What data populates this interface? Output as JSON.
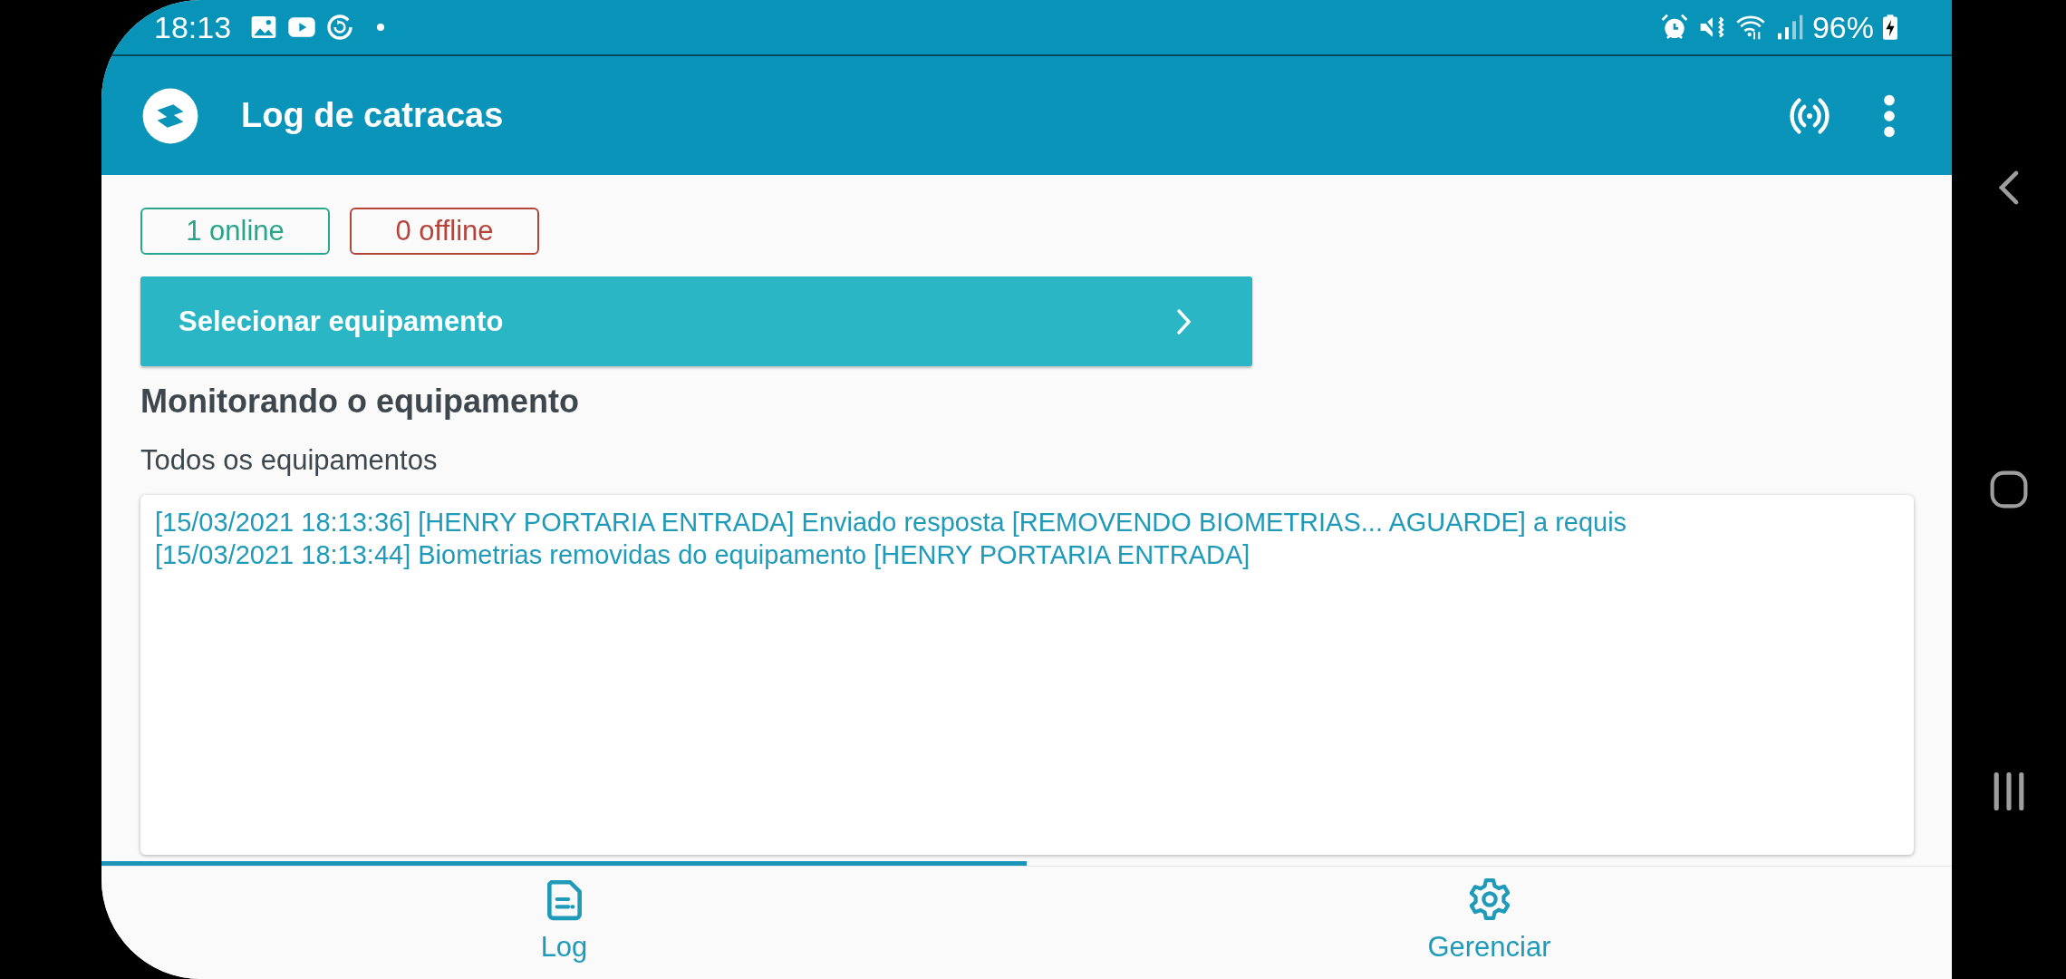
{
  "status_bar": {
    "time": "18:13",
    "battery": "96%"
  },
  "app_bar": {
    "title": "Log de catracas"
  },
  "badges": [
    {
      "label": "1 online",
      "color": "#2aa58a"
    },
    {
      "label": "0 offline",
      "color": "#b5453c"
    }
  ],
  "select_button": {
    "label": "Selecionar equipamento"
  },
  "heading": "Monitorando o equipamento",
  "subtitle": "Todos os equipamentos",
  "log_lines": [
    "[15/03/2021 18:13:36] [HENRY PORTARIA ENTRADA] Enviado resposta [REMOVENDO BIOMETRIAS... AGUARDE] a requis",
    "[15/03/2021 18:13:44] Biometrias removidas do equipamento [HENRY PORTARIA ENTRADA]"
  ],
  "tabs": [
    {
      "label": "Log",
      "kind": "log",
      "selected": true
    },
    {
      "label": "Gerenciar",
      "kind": "settings",
      "selected": false
    }
  ]
}
